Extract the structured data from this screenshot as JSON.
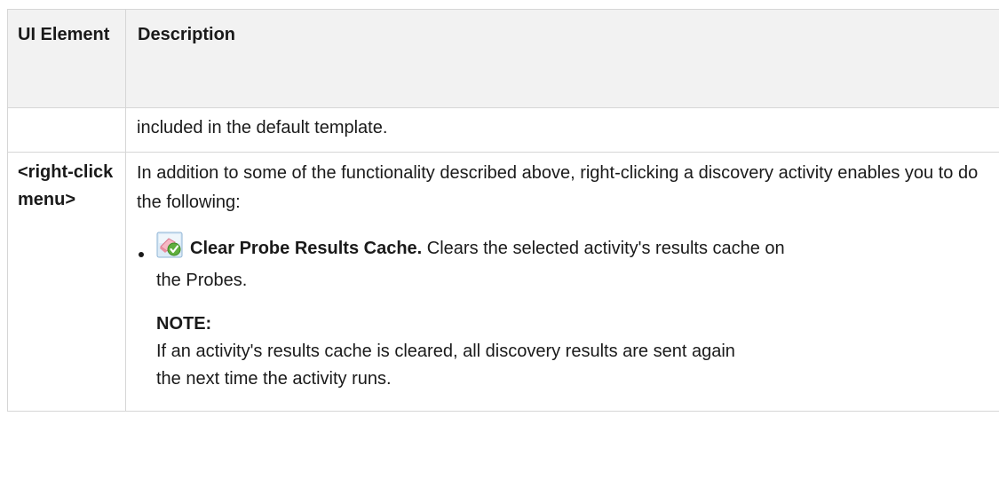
{
  "table": {
    "headers": {
      "ui_element": "UI Element",
      "description": "Description"
    },
    "rows": [
      {
        "element": "",
        "description": "included in the default template."
      },
      {
        "element": "<right-click menu>",
        "intro": "In addition to some of the functionality described above, right-clicking a discovery activity enables you to do the following:",
        "items": [
          {
            "icon": "clear-probe-results-cache-icon",
            "term": "Clear Probe Results Cache.",
            "text_line1": " Clears the selected activity's results cache on",
            "text_line2": "the Probes."
          }
        ],
        "note": {
          "heading": "NOTE:",
          "line1": "If an activity's results cache is cleared, all discovery results are sent again",
          "line2": "the next time the activity runs."
        }
      }
    ]
  }
}
